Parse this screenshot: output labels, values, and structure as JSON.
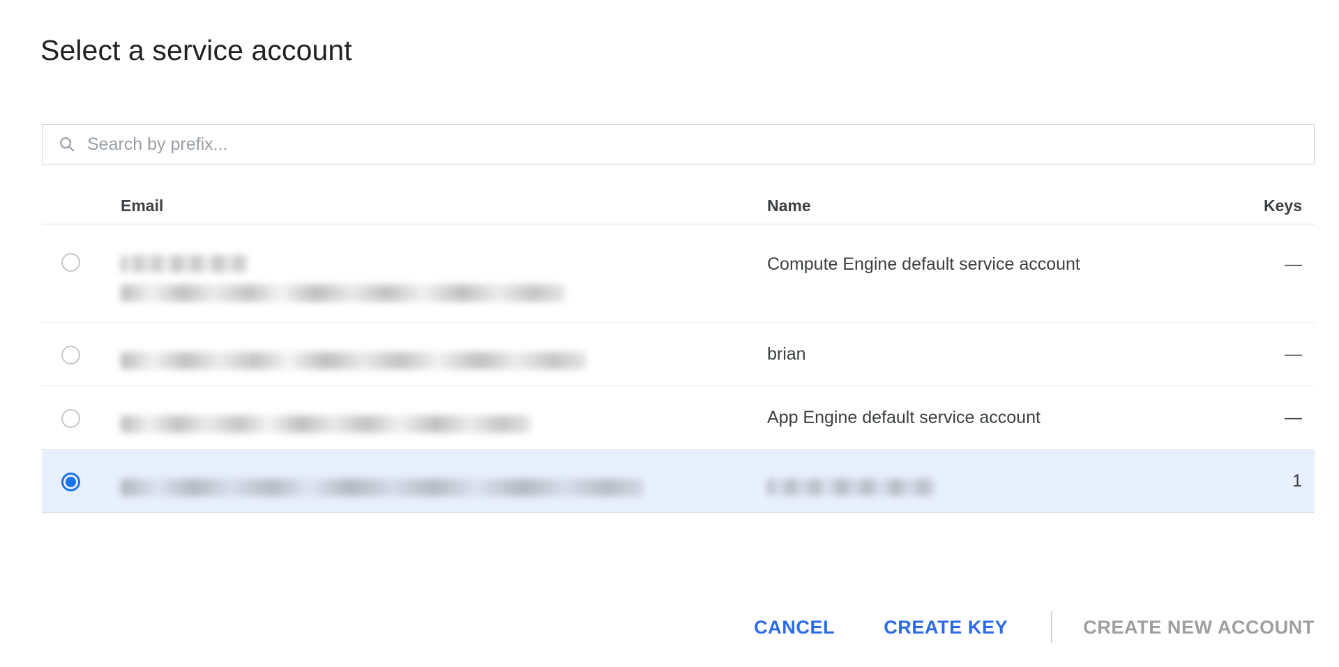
{
  "dialog": {
    "title": "Select a service account"
  },
  "search": {
    "placeholder": "Search by prefix...",
    "value": "",
    "icon": "search-icon"
  },
  "table": {
    "columns": {
      "email": "Email",
      "name": "Name",
      "keys": "Keys"
    },
    "rows": [
      {
        "selected": false,
        "email": "",
        "email_redacted": true,
        "email_lines": 2,
        "name": "Compute Engine default service account",
        "name_redacted": false,
        "keys": "—"
      },
      {
        "selected": false,
        "email": "",
        "email_redacted": true,
        "email_lines": 1,
        "name": "brian",
        "name_redacted": false,
        "keys": "—"
      },
      {
        "selected": false,
        "email": "",
        "email_redacted": true,
        "email_lines": 1,
        "name": "App Engine default service account",
        "name_redacted": false,
        "keys": "—"
      },
      {
        "selected": true,
        "email": "",
        "email_redacted": true,
        "email_lines": 1,
        "name": "",
        "name_redacted": true,
        "keys": "1"
      }
    ]
  },
  "footer": {
    "cancel_label": "CANCEL",
    "create_key_label": "CREATE KEY",
    "create_new_account_label": "CREATE NEW ACCOUNT"
  },
  "colors": {
    "accent": "#2a6ae9",
    "selected_row_bg": "#e8f0fe",
    "radio_selected": "#1a73e8",
    "muted_text": "#9e9e9e",
    "body_text": "#3c4043",
    "placeholder": "#9aa0a6"
  }
}
